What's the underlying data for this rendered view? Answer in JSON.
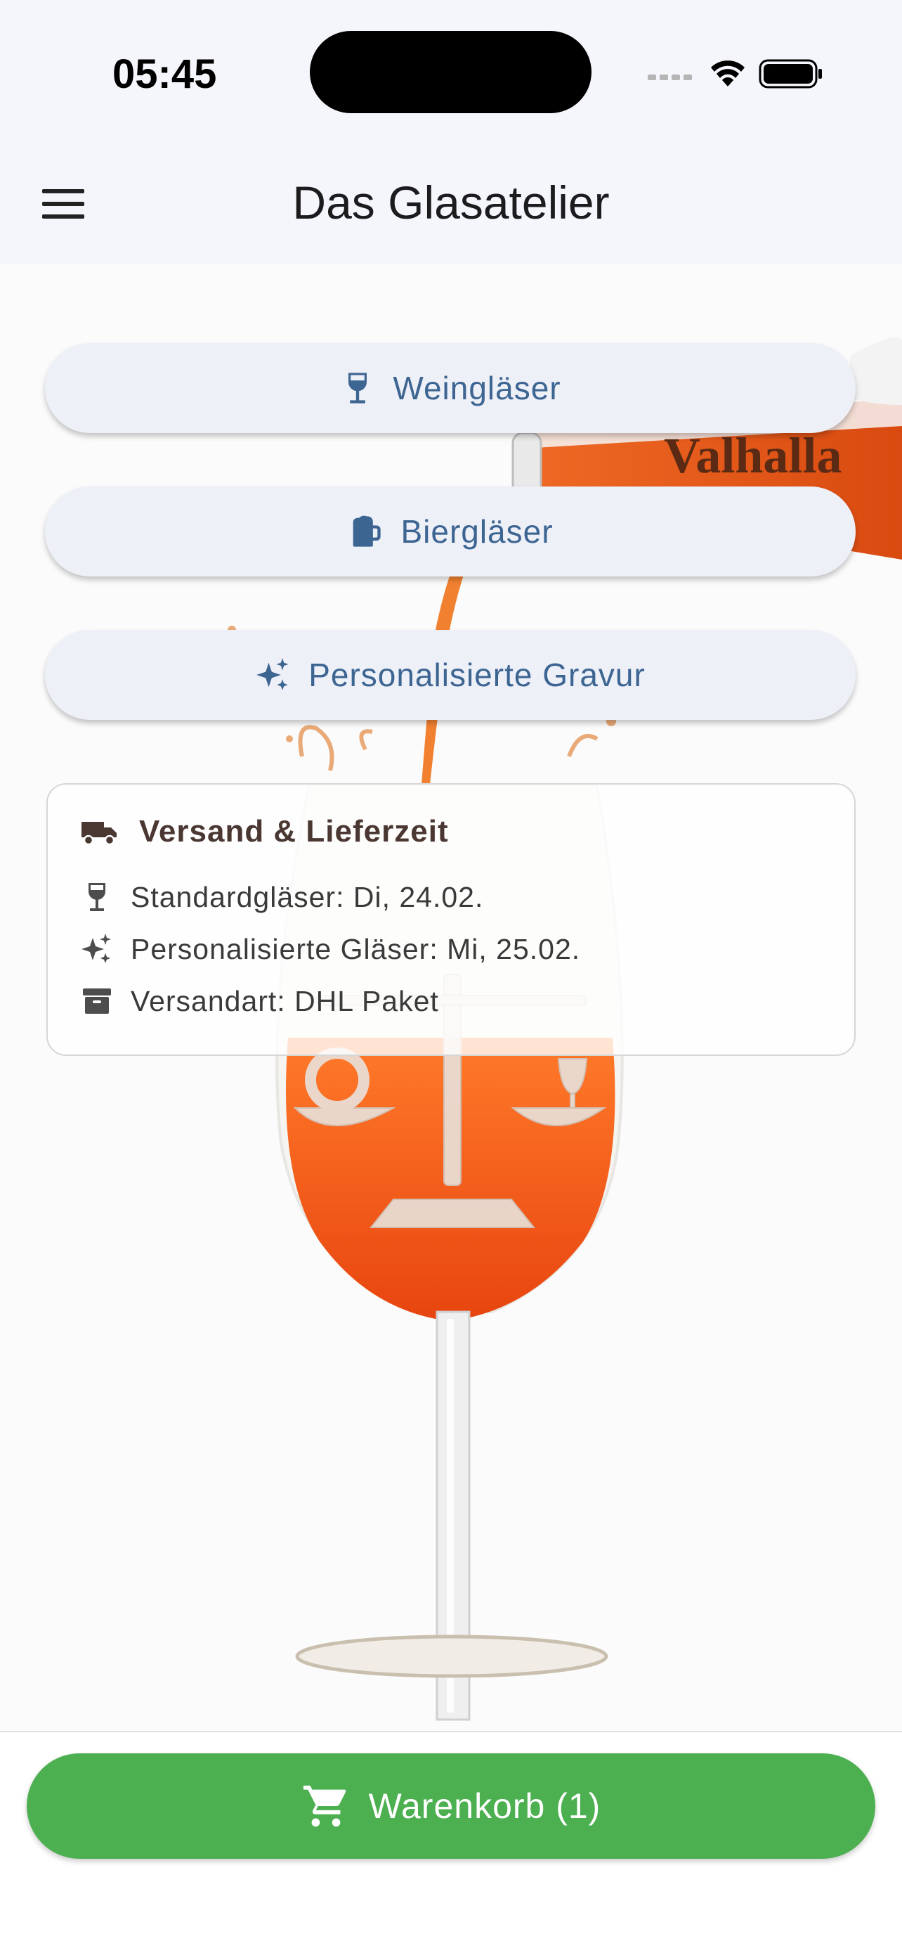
{
  "status_bar": {
    "time": "05:45",
    "icons": [
      "signal-icon",
      "wifi-icon",
      "battery-icon"
    ]
  },
  "app_bar": {
    "title": "Das Glasatelier",
    "menu_icon": "menu-icon"
  },
  "hero_image": {
    "bottle_label": "Valhalla"
  },
  "nav_buttons": [
    {
      "label": "Weingläser",
      "icon": "wine-glass-icon"
    },
    {
      "label": "Biergläser",
      "icon": "beer-mug-icon"
    },
    {
      "label": "Personalisierte Gravur",
      "icon": "sparkles-icon"
    }
  ],
  "shipping_card": {
    "title": "Versand & Lieferzeit",
    "title_icon": "truck-icon",
    "rows": [
      {
        "text": "Standardgläser: Di, 24.02.",
        "icon": "wine-glass-icon"
      },
      {
        "text": "Personalisierte Gläser: Mi, 25.02.",
        "icon": "sparkles-icon"
      },
      {
        "text": "Versandart: DHL Paket",
        "icon": "archive-box-icon"
      }
    ]
  },
  "cart": {
    "label": "Warenkorb (1)",
    "icon": "shopping-cart-icon"
  },
  "colors": {
    "accent_blue": "#3d6592",
    "cart_green": "#4caf50",
    "card_title": "#4a3732",
    "drink_orange": "#f05a1e"
  }
}
